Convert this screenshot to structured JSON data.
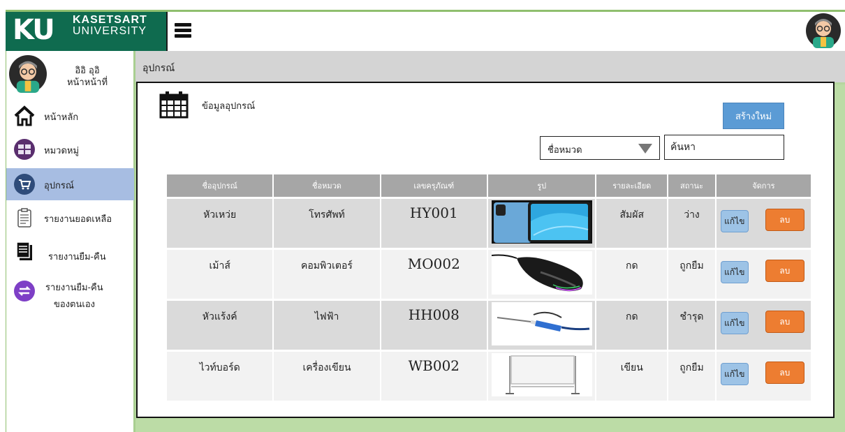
{
  "brand": {
    "logo_mark": "KU",
    "line1": "KASETSART",
    "line2": "UNIVERSITY",
    "color": "#0f6b4f"
  },
  "user": {
    "name": "อิอิ อุอิ",
    "role": "หน้าหน้าที่"
  },
  "sidebar": {
    "items": [
      {
        "label": "หน้าหลัก",
        "icon": "home-icon"
      },
      {
        "label": "หมวดหมู่",
        "icon": "category-icon"
      },
      {
        "label": "อุปกรณ์",
        "icon": "cart-icon",
        "active": true
      },
      {
        "label": "รายงานยอดเหลือ",
        "icon": "clipboard-icon"
      },
      {
        "label": "รายงานยืม-คืน",
        "icon": "documents-icon"
      },
      {
        "label": "รายงานยืม-คืน",
        "label2": "ของตนเอง",
        "icon": "exchange-icon"
      }
    ]
  },
  "breadcrumb": "อุปกรณ์",
  "panel": {
    "title": "ข้อมูลอุปกรณ์",
    "create_label": "สร้างใหม่",
    "category_select": "ชื่อหมวด",
    "search_placeholder": "ค้นหา"
  },
  "table": {
    "headers": [
      "ชื่ออุปกรณ์",
      "ชื่อหมวด",
      "เลขครุภัณฑ์",
      "รูป",
      "รายละเอียด",
      "สถานะ",
      "จัดการ"
    ],
    "rows": [
      {
        "name": "หัวเหว่ย",
        "category": "โทรศัพท์",
        "code": "HY001",
        "image": "phone-image",
        "detail": "สัมผัส",
        "status": "ว่าง"
      },
      {
        "name": "เม้าส์",
        "category": "คอมพิวเตอร์",
        "code": "MO002",
        "image": "mouse-image",
        "detail": "กด",
        "status": "ถูกยืม"
      },
      {
        "name": "หัวแร้งค์",
        "category": "ไฟฟ้า",
        "code": "HH008",
        "image": "soldering-iron-image",
        "detail": "กด",
        "status": "ชำรุด"
      },
      {
        "name": "ไวท์บอร์ด",
        "category": "เครื่องเขียน",
        "code": "WB002",
        "image": "whiteboard-image",
        "detail": "เขียน",
        "status": "ถูกยืม"
      }
    ],
    "edit_label": "แก้ไข",
    "delete_label": "ลบ"
  }
}
